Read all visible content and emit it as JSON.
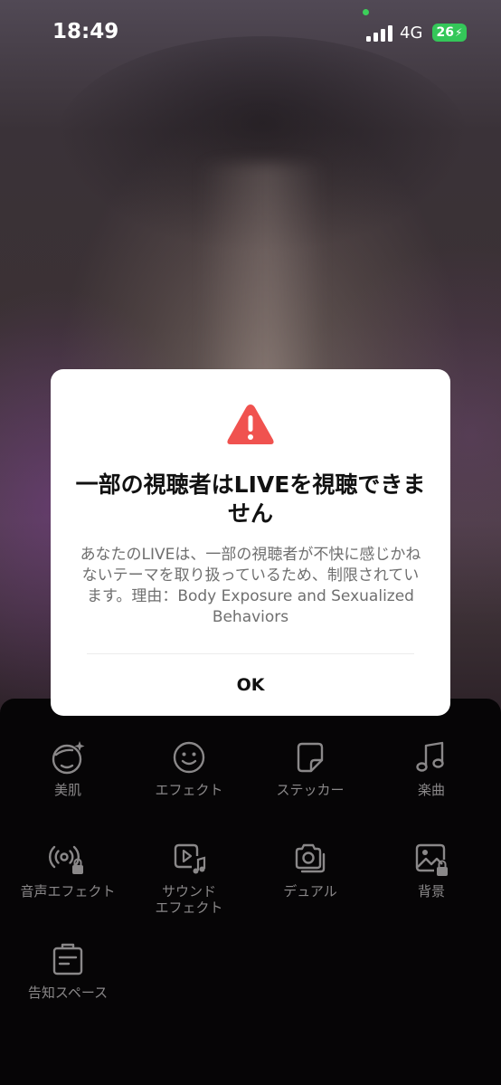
{
  "status_bar": {
    "time": "18:49",
    "network": "4G",
    "battery": "26"
  },
  "dialog": {
    "icon": "warning-triangle-icon",
    "title": "一部の視聴者はLIVEを視聴できません",
    "body": "あなたのLIVEは、一部の視聴者が不快に感じかねないテーマを取り扱っているため、制限されています。理由：Body Exposure and Sexualized Behaviors",
    "ok_label": "OK"
  },
  "tools": [
    {
      "icon": "face-sparkle-icon",
      "label": "美肌"
    },
    {
      "icon": "smiley-icon",
      "label": "エフェクト"
    },
    {
      "icon": "sticker-icon",
      "label": "ステッカー"
    },
    {
      "icon": "music-note-icon",
      "label": "楽曲"
    },
    {
      "icon": "voice-broadcast-locked-icon",
      "label": "音声エフェクト"
    },
    {
      "icon": "sound-video-icon",
      "label": "サウンド\nエフェクト"
    },
    {
      "icon": "dual-camera-icon",
      "label": "デュアル"
    },
    {
      "icon": "background-image-locked-icon",
      "label": "背景"
    },
    {
      "icon": "announcement-icon",
      "label": "告知スペース"
    }
  ],
  "colors": {
    "warning": "#f0524f",
    "battery": "#34c759",
    "panel_bg": "#060506",
    "tool_text": "#8a8889"
  }
}
